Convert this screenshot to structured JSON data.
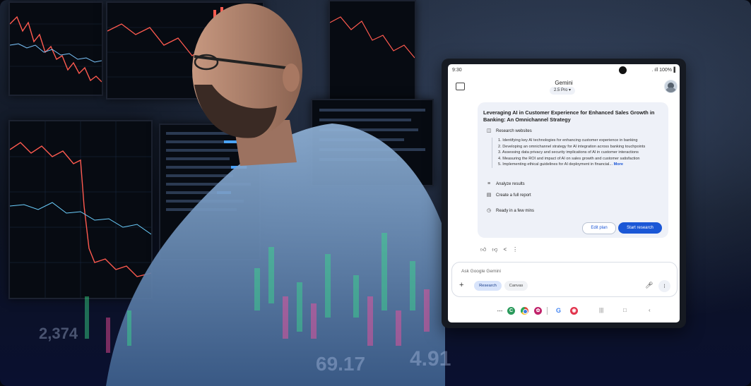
{
  "status_bar": {
    "time": "9:30",
    "signal": " . ıll 100%▐"
  },
  "app": {
    "title": "Gemini",
    "model": "2.5 Pro ▾"
  },
  "plan": {
    "title": "Leveraging AI in Customer Experience for Enhanced Sales Growth in Banking: An Omnichannel Strategy",
    "research_label": "Research websites",
    "steps": [
      "1. Identifying key AI technologies for enhancing customer experience in banking",
      "2. Developing an omnichannel strategy for AI integration across banking touchpoints",
      "3. Assessing data privacy and security implications of AI in customer interactions",
      "4. Measuring the ROI and impact of AI on sales growth and customer satisfaction",
      "5. Implementing ethical guidelines for AI deployment in financial..."
    ],
    "more_label": "More",
    "analyze_label": "Analyze results",
    "report_label": "Create a full report",
    "ready_label": "Ready in a few mins",
    "edit_label": "Edit plan",
    "start_label": "Start research"
  },
  "input": {
    "placeholder": "Ask Google Gemini",
    "research_chip": "Research",
    "canvas_chip": "Canvas"
  },
  "background_numbers": [
    "69.17",
    "4.91",
    "2,374"
  ],
  "colors": {
    "accent": "#1a57d6",
    "research_chip_bg": "#d8e4fb",
    "card_bg": "#eef1f8"
  },
  "icons": [
    "chat-icon",
    "avatar",
    "globe-icon",
    "analyze-icon",
    "report-icon",
    "clock-icon",
    "thumbs-up-icon",
    "thumbs-down-icon",
    "share-icon",
    "more-icon",
    "plus-icon",
    "mic-icon",
    "live-icon"
  ]
}
